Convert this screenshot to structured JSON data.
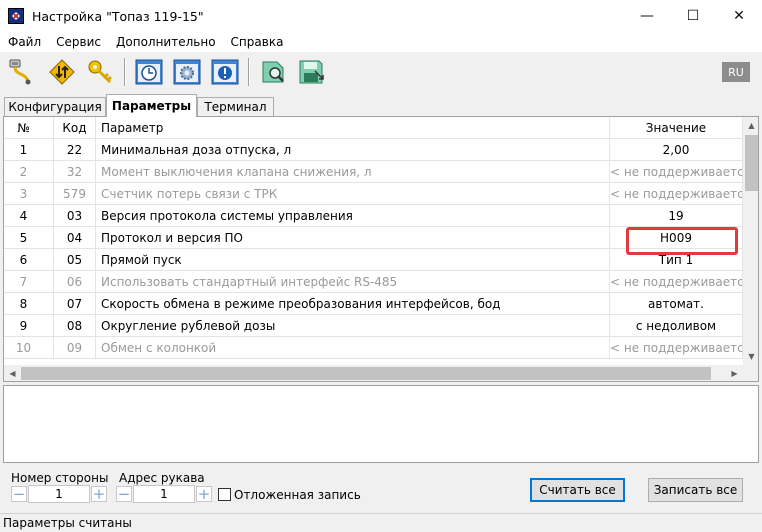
{
  "window": {
    "title": "Настройка \"Топаз 119-15\"",
    "minimize": "—",
    "maximize": "☐",
    "close": "✕"
  },
  "menu": [
    "Файл",
    "Сервис",
    "Дополнительно",
    "Справка"
  ],
  "toolbar": {
    "icons": [
      "connection-cable-icon",
      "transfer-arrows-icon",
      "key-icon",
      "clock-icon",
      "settings-gear-icon",
      "info-icon",
      "read-file-icon",
      "save-disk-icon"
    ],
    "language": "RU"
  },
  "tabs": [
    "Конфигурация",
    "Параметры",
    "Терминал"
  ],
  "table": {
    "headers": [
      "№",
      "Код",
      "Параметр",
      "Значение"
    ],
    "rows": [
      {
        "no": "1",
        "kod": "22",
        "param": "Минимальная доза отпуска, л",
        "value": "2,00",
        "disabled": false
      },
      {
        "no": "2",
        "kod": "32",
        "param": "Момент выключения клапана снижения, л",
        "value": "< не поддерживается >",
        "disabled": true
      },
      {
        "no": "3",
        "kod": "579",
        "param": "Счетчик потерь связи с ТРК",
        "value": "< не поддерживается >",
        "disabled": true
      },
      {
        "no": "4",
        "kod": "03",
        "param": "Версия протокола системы управления",
        "value": "19",
        "disabled": false
      },
      {
        "no": "5",
        "kod": "04",
        "param": "Протокол и версия ПО",
        "value": "H009",
        "disabled": false
      },
      {
        "no": "6",
        "kod": "05",
        "param": "Прямой пуск",
        "value": "Тип 1",
        "disabled": false
      },
      {
        "no": "7",
        "kod": "06",
        "param": "Использовать стандартный интерфейс RS-485",
        "value": "< не поддерживается >",
        "disabled": true
      },
      {
        "no": "8",
        "kod": "07",
        "param": "Скорость обмена в режиме преобразования интерфейсов, бод",
        "value": "автомат.",
        "disabled": false
      },
      {
        "no": "9",
        "kod": "08",
        "param": "Округление рублевой дозы",
        "value": "с недоливом",
        "disabled": false
      },
      {
        "no": "10",
        "kod": "09",
        "param": "Обмен с колонкой",
        "value": "< не поддерживается >",
        "disabled": true
      }
    ]
  },
  "bottom": {
    "side_label": "Номер стороны",
    "side_value": "1",
    "hose_label": "Адрес рукава",
    "hose_value": "1",
    "deferred_label": "Отложенная запись",
    "read_all": "Считать все",
    "write_all": "Записать все"
  },
  "status": "Параметры считаны",
  "colors": {
    "highlight": "#e03b3b",
    "disabled_text": "#9a9a9a",
    "accent": "#0078d7"
  }
}
